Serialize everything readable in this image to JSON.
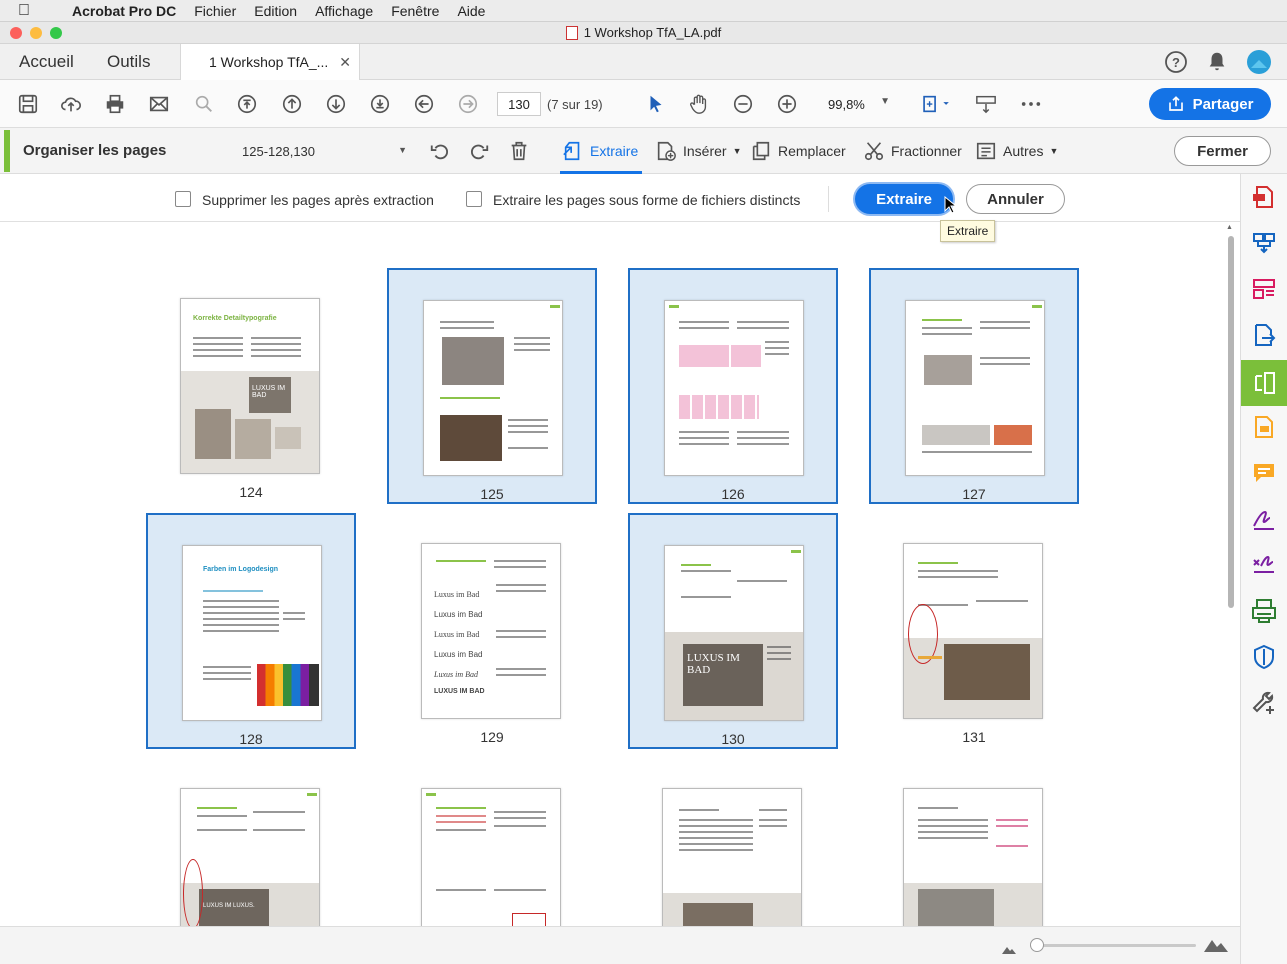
{
  "menubar": {
    "app": "Acrobat Pro DC",
    "items": [
      "Fichier",
      "Edition",
      "Affichage",
      "Fenêtre",
      "Aide"
    ]
  },
  "window": {
    "title": "1  Workshop TfA_LA.pdf"
  },
  "tabs": {
    "home": "Accueil",
    "tools": "Outils",
    "document": "1  Workshop TfA_..."
  },
  "toolbar": {
    "page_value": "130",
    "page_count": "(7 sur 19)",
    "zoom": "99,8%",
    "share_label": "Partager"
  },
  "organize": {
    "title": "Organiser les pages",
    "range": "125-128,130",
    "extract": "Extraire",
    "insert": "Insérer",
    "replace": "Remplacer",
    "split": "Fractionner",
    "more": "Autres",
    "close": "Fermer"
  },
  "extract_bar": {
    "option_delete": "Supprimer les pages après extraction",
    "option_separate": "Extraire les pages sous forme de fichiers distincts",
    "extract_button": "Extraire",
    "cancel_button": "Annuler",
    "tooltip": "Extraire"
  },
  "pages": [
    {
      "number": "124",
      "selected": false
    },
    {
      "number": "125",
      "selected": true
    },
    {
      "number": "126",
      "selected": true
    },
    {
      "number": "127",
      "selected": true
    },
    {
      "number": "128",
      "selected": true
    },
    {
      "number": "129",
      "selected": false
    },
    {
      "number": "130",
      "selected": true
    },
    {
      "number": "131",
      "selected": false
    }
  ],
  "thumb_text": {
    "p124_title": "Korrekte Detailtypografie",
    "p124_img": "LUXUS IM BAD",
    "p128_title": "Farben im Logodesign",
    "p129_l1": "Luxus im Bad",
    "p129_l2": "Luxus im Bad",
    "p129_l3": "Luxus im Bad",
    "p129_l4": "Luxus im Bad",
    "p129_l5": "Luxus im Bad",
    "p129_l6": "LUXUS IM BAD",
    "p130_img": "LUXUS IM BAD",
    "p132_img": "LUXUS IM LUXUS."
  },
  "colors": {
    "accent": "#1473e6",
    "selection": "#dbe9f6",
    "organize_green": "#7bbf3a"
  }
}
